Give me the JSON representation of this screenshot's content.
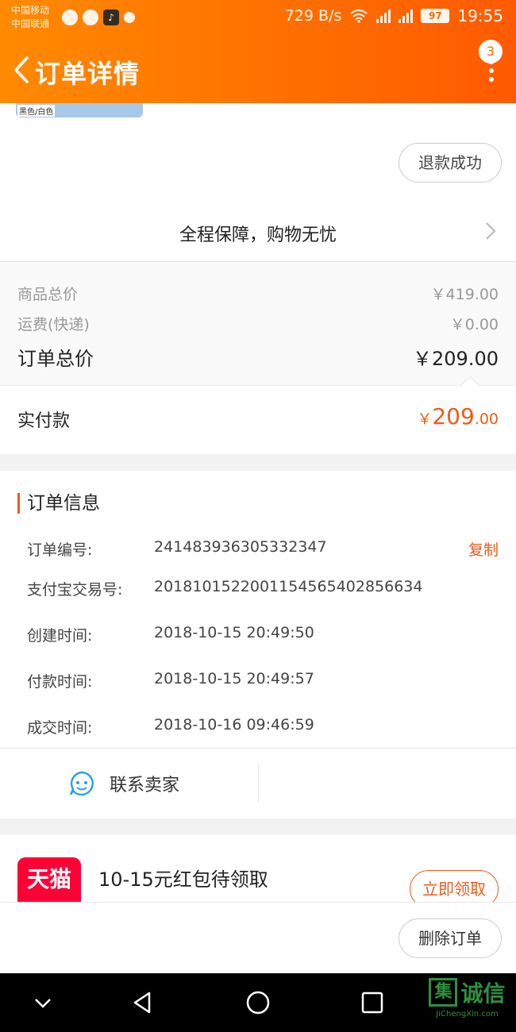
{
  "status_bar": {
    "carrier1": "中国移动",
    "carrier2": "中国联通",
    "speed": "729 B/s",
    "battery": "97",
    "time": "19:55"
  },
  "header": {
    "title": "订单详情",
    "badge_count": "3"
  },
  "product": {
    "spec_label": "黑色/白色",
    "refund_status": "退款成功"
  },
  "guarantee": {
    "text": "全程保障，购物无忧"
  },
  "prices": {
    "goods_total_label": "商品总价",
    "goods_total_value": "￥419.00",
    "shipping_label": "运费(快递)",
    "shipping_value": "￥0.00",
    "order_total_label": "订单总价",
    "order_total_value": "￥209.00",
    "paid_label": "实付款",
    "paid_currency": "￥",
    "paid_integer": "209",
    "paid_decimal": ".00"
  },
  "order_info": {
    "heading": "订单信息",
    "rows": [
      {
        "key": "订单编号:",
        "value": "241483936305332347"
      },
      {
        "key": "支付宝交易号:",
        "value": "2018101522001154565402856634"
      },
      {
        "key": "创建时间:",
        "value": "2018-10-15 20:49:50"
      },
      {
        "key": "付款时间:",
        "value": "2018-10-15 20:49:57"
      },
      {
        "key": "成交时间:",
        "value": "2018-10-16 09:46:59"
      }
    ],
    "copy_label": "复制",
    "contact_label": "联系卖家"
  },
  "coupon": {
    "logo_text": "天猫",
    "title": "10-15元红包待领取",
    "claim_label": "立即领取"
  },
  "bottom": {
    "delete_label": "删除订单"
  },
  "watermark": {
    "glyph": "集",
    "text": "诚信",
    "sub": "JiChengXin.com"
  },
  "colors": {
    "header_start": "#ff8a00",
    "header_end": "#ff5a00",
    "accent": "#f05a1a",
    "tmall": "#ff0036"
  }
}
